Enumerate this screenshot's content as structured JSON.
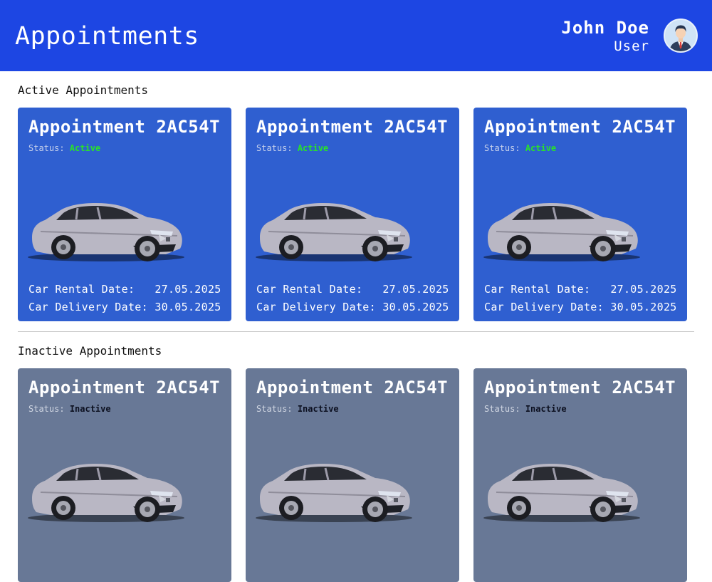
{
  "header": {
    "title": "Appointments",
    "user_name": "John Doe",
    "user_role": "User",
    "background_color": "#1d46e3"
  },
  "sections": {
    "active_title": "Active Appointments",
    "inactive_title": "Inactive Appointments"
  },
  "active_cards": [
    {
      "title": "Appointment 2AC54T",
      "status_label": "Status:",
      "status": "Active",
      "rental_label": "Car Rental Date:  ",
      "rental_date": "27.05.2025",
      "delivery_label": "Car Delivery Date:",
      "delivery_date": "30.05.2025"
    },
    {
      "title": "Appointment 2AC54T",
      "status_label": "Status:",
      "status": "Active",
      "rental_label": "Car Rental Date:  ",
      "rental_date": "27.05.2025",
      "delivery_label": "Car Delivery Date:",
      "delivery_date": "30.05.2025"
    },
    {
      "title": "Appointment 2AC54T",
      "status_label": "Status:",
      "status": "Active",
      "rental_label": "Car Rental Date:  ",
      "rental_date": "27.05.2025",
      "delivery_label": "Car Delivery Date:",
      "delivery_date": "30.05.2025"
    }
  ],
  "inactive_cards": [
    {
      "title": "Appointment 2AC54T",
      "status_label": "Status:",
      "status": "Inactive"
    },
    {
      "title": "Appointment 2AC54T",
      "status_label": "Status:",
      "status": "Inactive"
    },
    {
      "title": "Appointment 2AC54T",
      "status_label": "Status:",
      "status": "Inactive"
    }
  ],
  "colors": {
    "active_card": "#2f5fd0",
    "inactive_card": "#687896",
    "active_status": "#29e02c",
    "inactive_status": "#0c1020"
  },
  "icons": {
    "avatar": "user-avatar-icon",
    "car": "car-image"
  }
}
